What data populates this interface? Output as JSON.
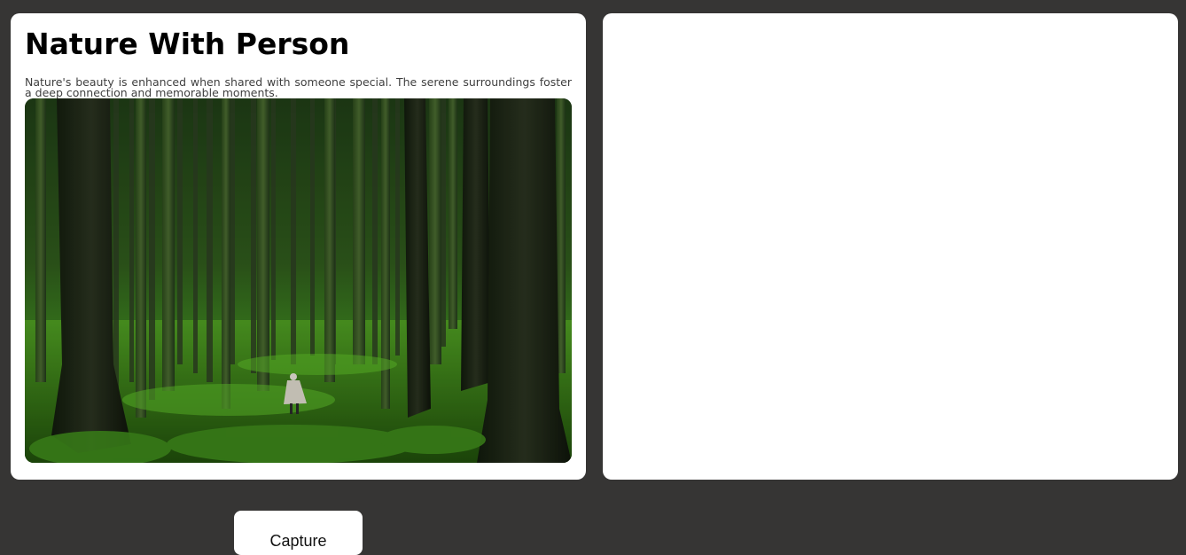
{
  "card": {
    "title": "Nature With Person",
    "description": "Nature's beauty is enhanced when shared with someone special. The serene surroundings foster a deep connection and memorable moments."
  },
  "image": {
    "subject": "forest-with-person-photo"
  },
  "actions": {
    "capture_label": "Capture"
  },
  "colors": {
    "page_background": "#363534",
    "card_background": "#ffffff",
    "button_background": "#ffffff"
  }
}
